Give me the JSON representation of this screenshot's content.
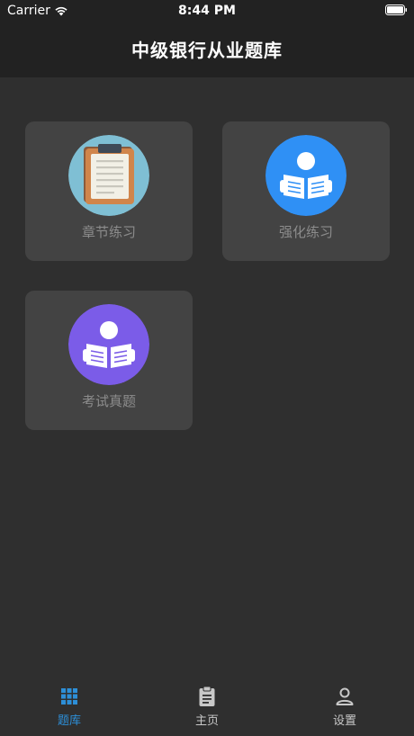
{
  "status_bar": {
    "carrier": "Carrier",
    "time": "8:44 PM"
  },
  "header": {
    "title": "中级银行从业题库"
  },
  "tiles": [
    {
      "label": "章节练习",
      "icon": "clipboard-icon",
      "color": "#7fbfd4"
    },
    {
      "label": "强化练习",
      "icon": "reader-icon",
      "color": "#2f90f5"
    },
    {
      "label": "考试真题",
      "icon": "reader-icon",
      "color": "#7b5ce8"
    }
  ],
  "tab_bar": {
    "active_color": "#2d8fd8",
    "inactive_color": "#c8c8c8",
    "tabs": [
      {
        "label": "题库",
        "icon": "grid-icon",
        "active": true
      },
      {
        "label": "主页",
        "icon": "clipboard-icon",
        "active": false
      },
      {
        "label": "设置",
        "icon": "user-icon",
        "active": false
      }
    ]
  }
}
